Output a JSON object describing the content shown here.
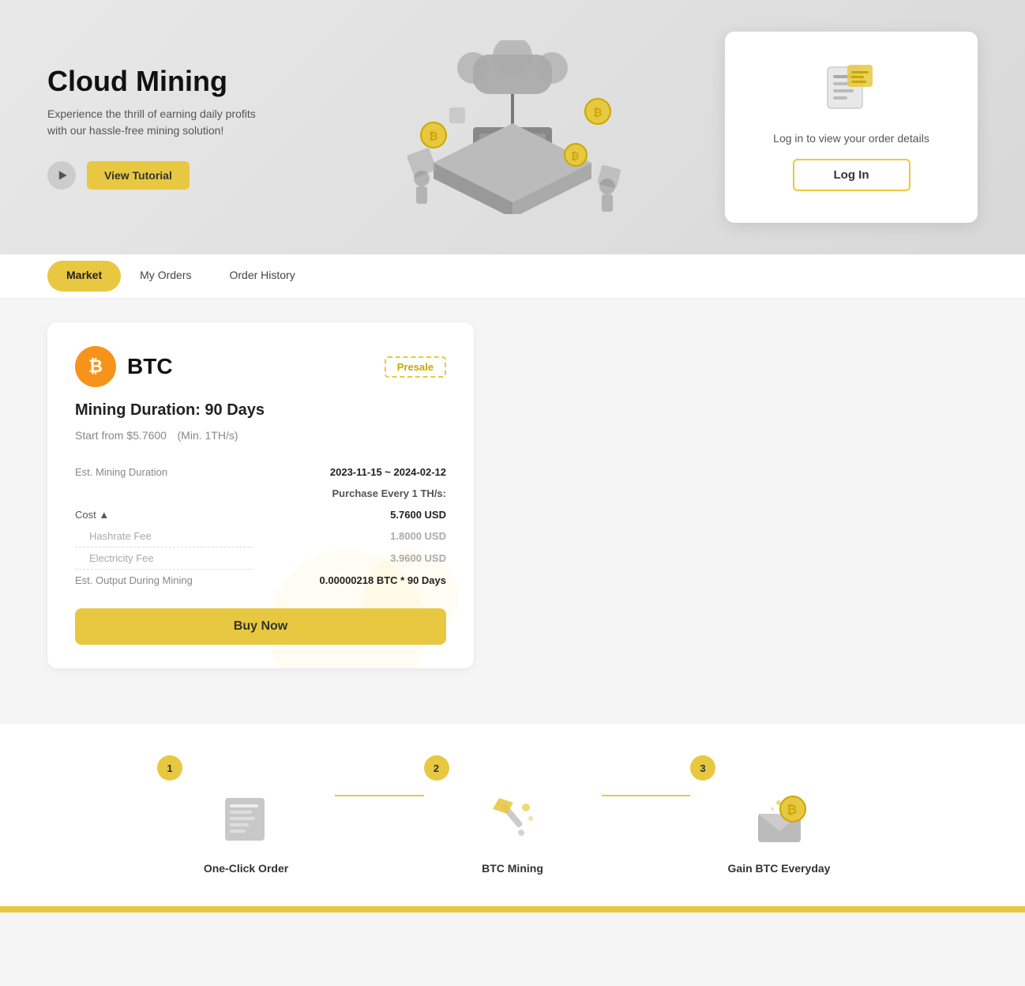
{
  "hero": {
    "title": "Cloud Mining",
    "subtitle": "Experience the thrill of earning daily profits with our hassle-free mining solution!",
    "view_tutorial_label": "View Tutorial",
    "play_icon": "▶"
  },
  "login_card": {
    "text": "Log in to view your order details",
    "button_label": "Log In"
  },
  "nav": {
    "tabs": [
      {
        "label": "Market",
        "active": true
      },
      {
        "label": "My Orders",
        "active": false
      },
      {
        "label": "Order History",
        "active": false
      }
    ]
  },
  "mining_card": {
    "coin": "₿",
    "coin_name": "BTC",
    "presale_label": "Presale",
    "duration_label": "Mining Duration: 90 Days",
    "start_from_label": "Start from $5.7600",
    "min_label": "(Min. 1TH/s)",
    "est_duration_label": "Est. Mining Duration",
    "est_duration_value": "2023-11-15 ~ 2024-02-12",
    "purchase_label": "Purchase Every 1 TH/s:",
    "cost_label": "Cost ▲",
    "cost_value": "5.7600 USD",
    "hashrate_fee_label": "Hashrate Fee",
    "hashrate_fee_value": "1.8000 USD",
    "electricity_fee_label": "Electricity Fee",
    "electricity_fee_value": "3.9600 USD",
    "est_output_label": "Est. Output During Mining",
    "est_output_value": "0.00000218 BTC * 90 Days",
    "buy_now_label": "Buy Now"
  },
  "steps": [
    {
      "number": "1",
      "label": "One-Click Order",
      "icon": "🖥️"
    },
    {
      "number": "2",
      "label": "BTC Mining",
      "icon": "⛏️"
    },
    {
      "number": "3",
      "label": "Gain BTC Everyday",
      "icon": "💰"
    }
  ]
}
